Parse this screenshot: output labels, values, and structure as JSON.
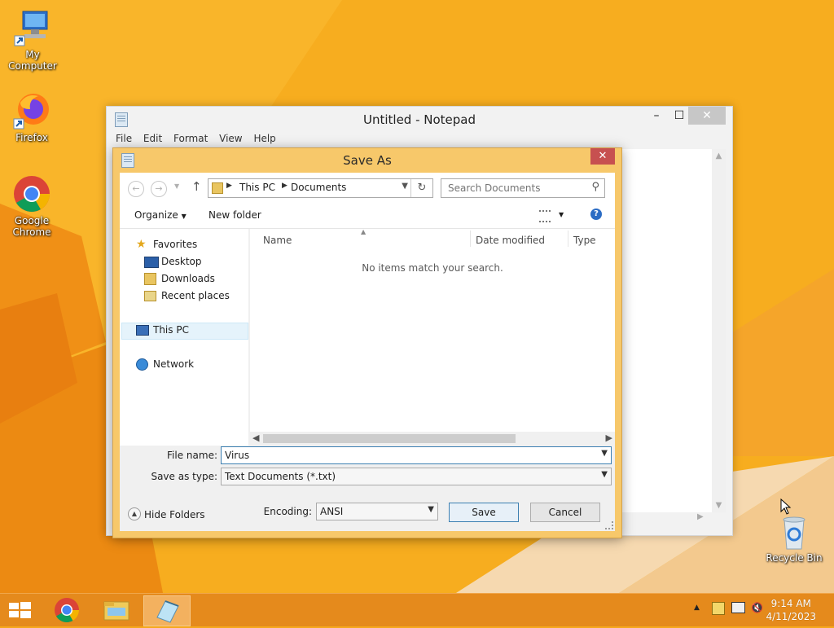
{
  "desktop": {
    "icons": [
      {
        "label": "My Computer"
      },
      {
        "label": "Firefox"
      },
      {
        "label": "Google Chrome"
      },
      {
        "label": "Recycle Bin"
      }
    ]
  },
  "notepad": {
    "title": "Untitled - Notepad",
    "menu": [
      "File",
      "Edit",
      "Format",
      "View",
      "Help"
    ]
  },
  "saveas": {
    "title": "Save As",
    "close_glyph": "✕",
    "breadcrumb": [
      "This PC",
      "Documents"
    ],
    "search_placeholder": "Search Documents",
    "commands": {
      "organize": "Organize",
      "new_folder": "New folder"
    },
    "nav": {
      "favorites": "Favorites",
      "desktop": "Desktop",
      "downloads": "Downloads",
      "recent": "Recent places",
      "this_pc": "This PC",
      "network": "Network"
    },
    "columns": {
      "name": "Name",
      "date_modified": "Date modified",
      "type": "Type"
    },
    "empty_message": "No items match your search.",
    "file_name_label": "File name:",
    "file_name_value": "Virus",
    "save_as_type_label": "Save as type:",
    "save_as_type_value": "Text Documents (*.txt)",
    "hide_folders": "Hide Folders",
    "encoding_label": "Encoding:",
    "encoding_value": "ANSI",
    "save_label": "Save",
    "cancel_label": "Cancel"
  },
  "taskbar": {
    "time": "9:14 AM",
    "date": "4/11/2023"
  },
  "colors": {
    "desktop_bg": "#f6a81c",
    "taskbar": "#e58a1c",
    "dialog_frame": "#f7c86a",
    "close_red": "#c75050"
  }
}
